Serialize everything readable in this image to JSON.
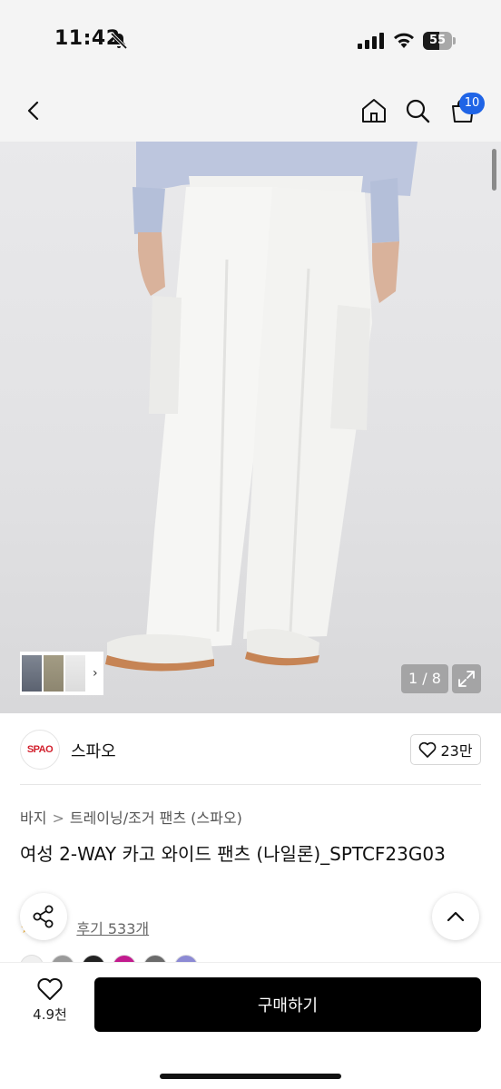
{
  "status_bar": {
    "time": "11:42",
    "battery_percent": 55,
    "battery_text": "55"
  },
  "nav": {
    "cart_count": "10",
    "icons": [
      "back-chevron-icon",
      "home-icon",
      "search-icon",
      "cart-icon"
    ]
  },
  "gallery": {
    "counter": "1 / 8",
    "thumb_arrow": "›"
  },
  "brand": {
    "logo_text": "SPAO",
    "name": "스파오",
    "likes": "23만",
    "logo_color": "#d21f2c"
  },
  "breadcrumb": {
    "items": [
      "바지",
      "트레이닝/조거 팬츠 (스파오)"
    ],
    "separator": ">"
  },
  "product": {
    "title": "여성 2-WAY 카고 와이드 팬츠 (나일론)_SPTCF23G03"
  },
  "reviews": {
    "label": "후기 533개"
  },
  "bottom_bar": {
    "wish_count": "4.9천",
    "buy_label": "구매하기"
  },
  "colors": {
    "accent": "#1f64e6",
    "buy_button": "#000000",
    "star": "#f2b33d"
  }
}
